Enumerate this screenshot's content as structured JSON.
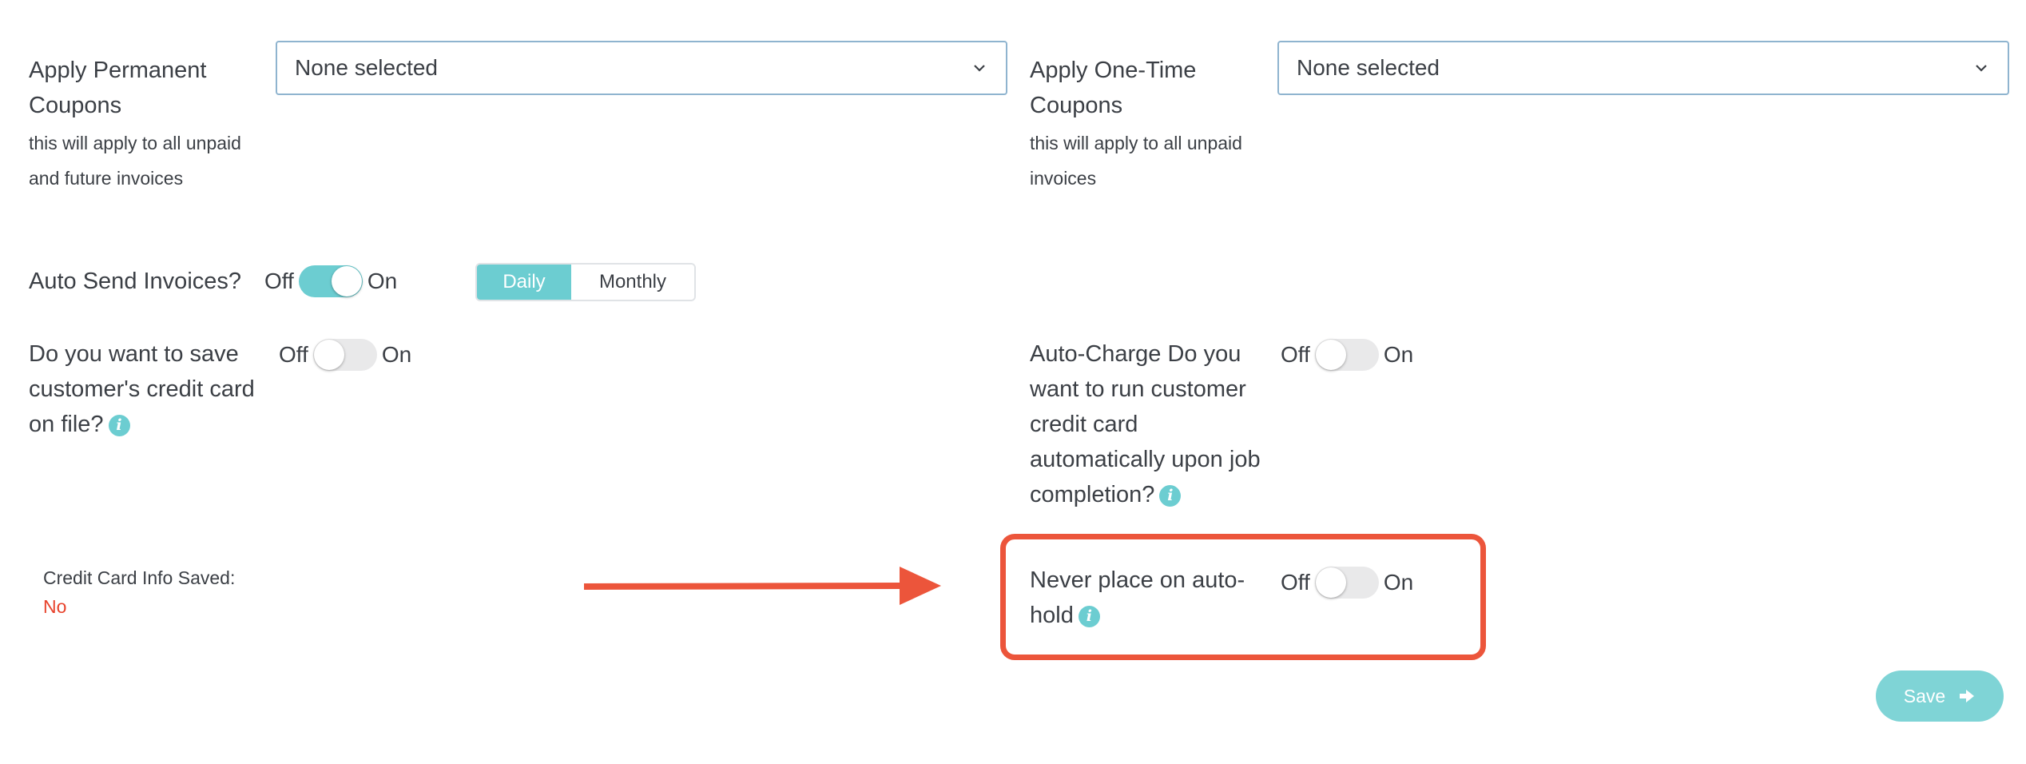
{
  "colors": {
    "accent": "#6ccdd1",
    "annotation": "#ec553b",
    "error_text": "#e8432c"
  },
  "permanent_coupons": {
    "label": "Apply Permanent Coupons",
    "help": "this will apply to all unpaid and future invoices",
    "select_value": "None selected"
  },
  "one_time_coupons": {
    "label": "Apply One-Time Coupons",
    "help": "this will apply to all unpaid invoices",
    "select_value": "None selected"
  },
  "auto_send": {
    "label": "Auto Send Invoices?",
    "off_label": "Off",
    "on_label": "On",
    "state": "on",
    "frequency_options": [
      "Daily",
      "Monthly"
    ],
    "frequency_selected": "Daily"
  },
  "save_card": {
    "label": "Do you want to save customer's credit card on file?",
    "off_label": "Off",
    "on_label": "On",
    "state": "off"
  },
  "auto_charge": {
    "label": "Auto-Charge Do you want to run customer credit card automatically upon job completion?",
    "off_label": "Off",
    "on_label": "On",
    "state": "off"
  },
  "card_info": {
    "label": "Credit Card Info Saved:",
    "value": "No"
  },
  "auto_hold": {
    "label": "Never place on auto-hold",
    "off_label": "Off",
    "on_label": "On",
    "state": "off"
  },
  "save_button": {
    "label": "Save",
    "icon": "arrow-right-icon"
  }
}
